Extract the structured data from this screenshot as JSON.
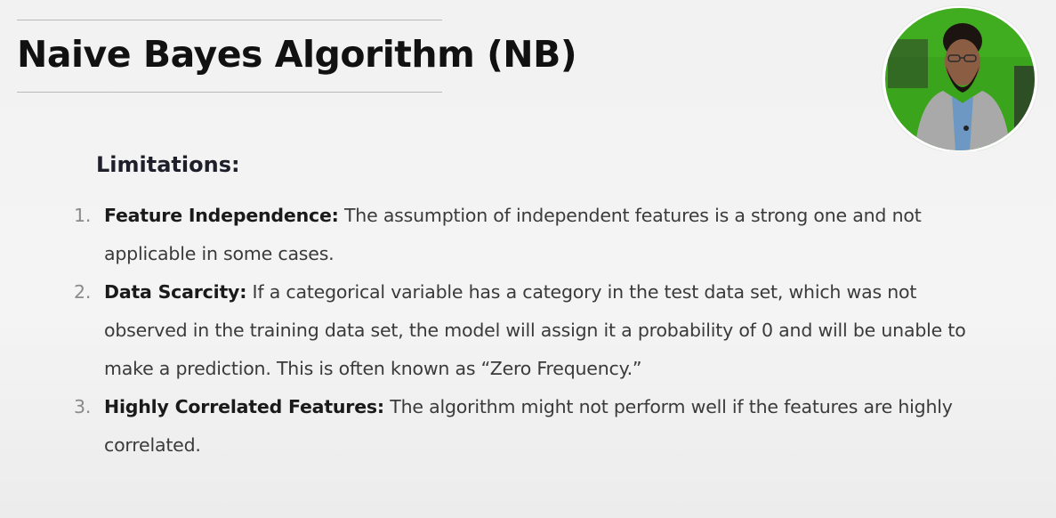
{
  "slide": {
    "title": "Naive Bayes Algorithm (NB)",
    "section_heading": "Limitations:",
    "items": [
      {
        "number": "1.",
        "term": "Feature Independence:",
        "text": " The assumption of independent features is a strong one and not applicable in some cases."
      },
      {
        "number": "2.",
        "term": "Data Scarcity:",
        "text": " If a categorical variable has a category in the test data set, which was not observed in the training data set, the model will assign it a probability of 0 and will be unable to make a prediction. This is often known as “Zero Frequency.”"
      },
      {
        "number": "3.",
        "term": "Highly Correlated Features:",
        "text": " The algorithm might not perform well if the features are highly correlated."
      }
    ]
  },
  "webcam": {
    "icon": "presenter-webcam",
    "background_color": "#3aa51c",
    "jacket_color": "#a9a9a9"
  }
}
